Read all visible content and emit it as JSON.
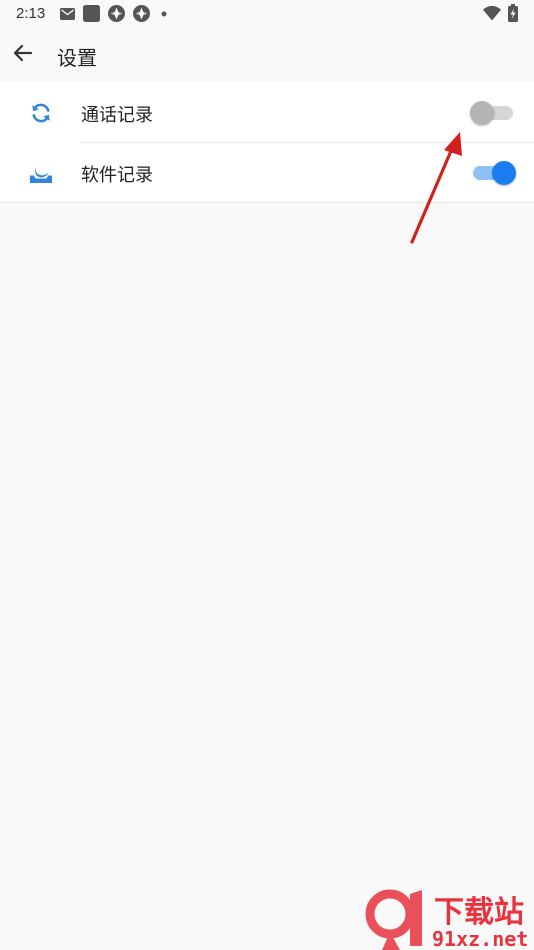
{
  "status_bar": {
    "time": "2:13"
  },
  "header": {
    "back_icon": "arrow-left-icon",
    "title": "设置"
  },
  "settings": [
    {
      "label": "通话记录",
      "icon": "sync-icon",
      "enabled": false
    },
    {
      "label": "软件记录",
      "icon": "tray-icon",
      "enabled": true
    }
  ],
  "colors": {
    "accent": "#1a7cf0",
    "icon_blue": "#2f86d6",
    "toggle_off": "#b5b5b5",
    "annotation": "#d2211c"
  },
  "watermark": {
    "logo_text": "下载站",
    "url": "91xz.net"
  }
}
